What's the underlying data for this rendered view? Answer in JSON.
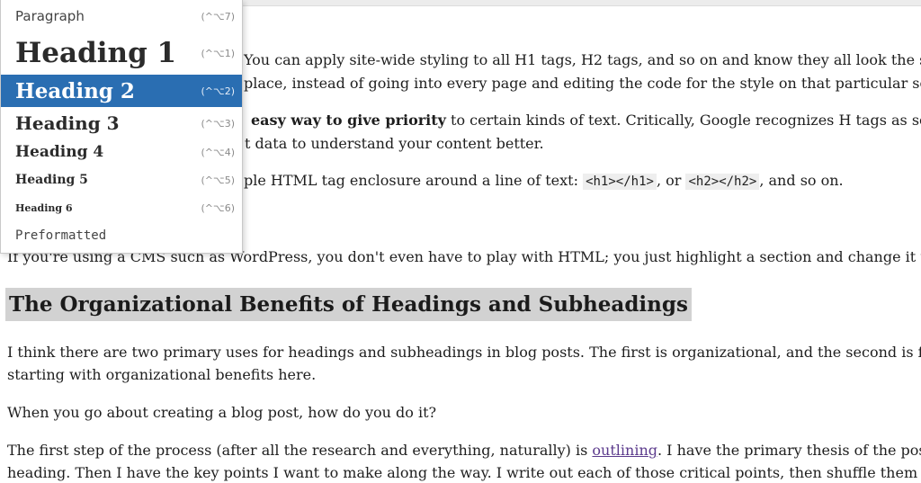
{
  "format_menu": {
    "items": [
      {
        "label": "Paragraph",
        "shortcut": "(^⌥7)"
      },
      {
        "label": "Heading 1",
        "shortcut": "(^⌥1)"
      },
      {
        "label": "Heading 2",
        "shortcut": "(^⌥2)",
        "selected": true
      },
      {
        "label": "Heading 3",
        "shortcut": "(^⌥3)"
      },
      {
        "label": "Heading 4",
        "shortcut": "(^⌥4)"
      },
      {
        "label": "Heading 5",
        "shortcut": "(^⌥5)"
      },
      {
        "label": "Heading 6",
        "shortcut": "(^⌥6)"
      },
      {
        "label": "Preformatted",
        "shortcut": ""
      }
    ]
  },
  "content": {
    "p1_l1": "You can apply site-wide styling to all H1 tags, H2 tags, and so on and know they all look the same. Mo",
    "p1_l2": "place, instead of going into every page and editing the code for the style on that particular section for e",
    "p2_l1_bold": "easy way to give priority",
    "p2_l1_rest": " to certain kinds of text. Critically, Google recognizes H tags as sections o",
    "p2_l2": "t data to understand your content better.",
    "p3_pre": "ple HTML tag enclosure around a line of text: ",
    "p3_code1": "<h1></h1>",
    "p3_mid": ", or ",
    "p3_code2": "<h2></h2>",
    "p3_post": ", and so on.",
    "p4": "If you're using a CMS such as WordPress, you don't even have to play with HTML; you just highlight a section and change it to the headin",
    "heading": "The Organizational Benefits of Headings and Subheadings",
    "p5_l1": "I think there are two primary uses for headings and subheadings in blog posts. The first is organizational, and the second is for SEO value",
    "p5_l2": "starting with organizational benefits here.",
    "p6": "When you go about creating a blog post, how do you do it?",
    "p7_l1_pre": "The first step of the process (after all the research and everything, naturally) is ",
    "p7_l1_link": "outlining",
    "p7_l1_post": ". I have the primary thesis of the post, which ends",
    "p7_l2": "heading. Then I have the key points I want to make along the way. I write out each of those critical points, then shuffle them around to giv"
  }
}
